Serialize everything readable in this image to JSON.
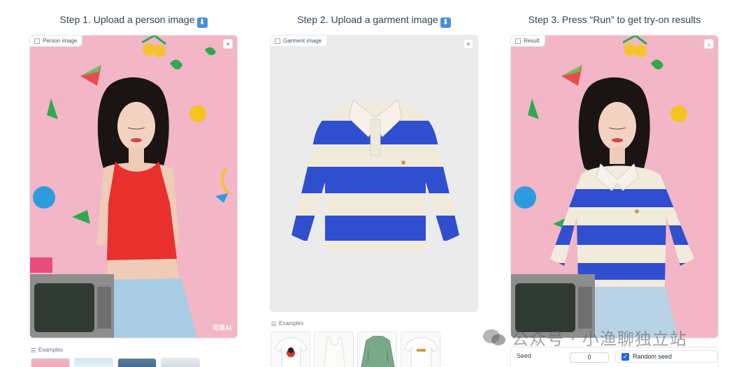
{
  "steps": {
    "step1": "Step 1. Upload a person image",
    "step2": "Step 2. Upload a garment image",
    "step3": "Step 3. Press “Run” to get try-on results"
  },
  "person_panel": {
    "label": "Person image",
    "close_icon": "close-icon",
    "brand_mark": "可灵AI"
  },
  "garment_panel": {
    "label": "Garment image",
    "close_icon": "close-icon"
  },
  "result_panel": {
    "label": "Result",
    "download_icon": "download-icon"
  },
  "examples": {
    "label": "Examples"
  },
  "settings": {
    "seed_label": "Seed",
    "seed_value": "0",
    "random_seed_label": "Random seed",
    "random_seed_checked": true
  },
  "watermark": {
    "text": "公众号 · 小渔聊独立站"
  },
  "colors": {
    "accent": "#2563eb",
    "wallpaper": "#f0b2c4",
    "stripe_blue": "#2f4fcf",
    "stripe_cream": "#f1ebdc",
    "top_red": "#e8312c",
    "jeans": "#a9cde4"
  }
}
